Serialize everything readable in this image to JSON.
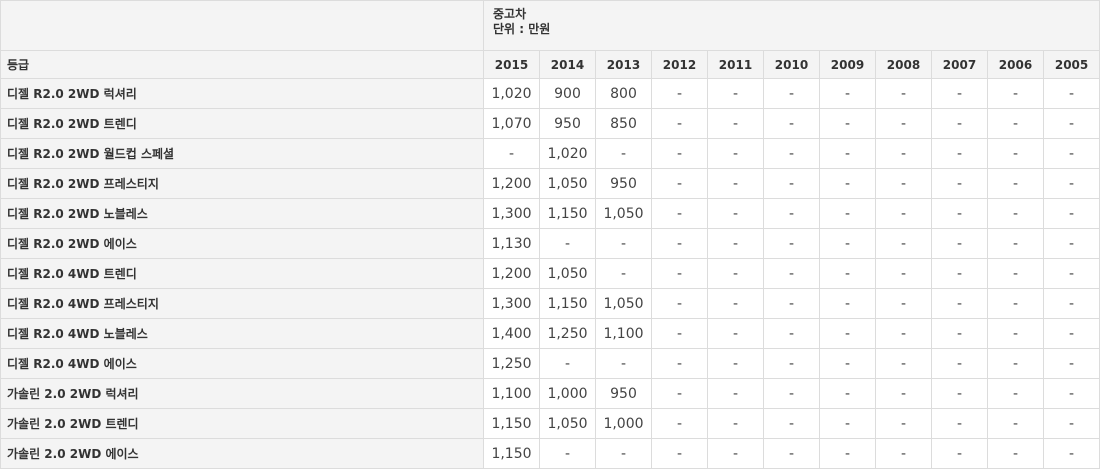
{
  "header": {
    "title": "중고차",
    "unit": "단위 : 만원",
    "grade_label": "등급",
    "years": [
      "2015",
      "2014",
      "2013",
      "2012",
      "2011",
      "2010",
      "2009",
      "2008",
      "2007",
      "2006",
      "2005"
    ]
  },
  "rows": [
    {
      "grade": "디젤 R2.0 2WD 럭셔리",
      "values": [
        "1,020",
        "900",
        "800",
        "-",
        "-",
        "-",
        "-",
        "-",
        "-",
        "-",
        "-"
      ]
    },
    {
      "grade": "디젤 R2.0 2WD 트렌디",
      "values": [
        "1,070",
        "950",
        "850",
        "-",
        "-",
        "-",
        "-",
        "-",
        "-",
        "-",
        "-"
      ]
    },
    {
      "grade": "디젤 R2.0 2WD 월드컵 스페셜",
      "values": [
        "-",
        "1,020",
        "-",
        "-",
        "-",
        "-",
        "-",
        "-",
        "-",
        "-",
        "-"
      ]
    },
    {
      "grade": "디젤 R2.0 2WD 프레스티지",
      "values": [
        "1,200",
        "1,050",
        "950",
        "-",
        "-",
        "-",
        "-",
        "-",
        "-",
        "-",
        "-"
      ]
    },
    {
      "grade": "디젤 R2.0 2WD 노블레스",
      "values": [
        "1,300",
        "1,150",
        "1,050",
        "-",
        "-",
        "-",
        "-",
        "-",
        "-",
        "-",
        "-"
      ]
    },
    {
      "grade": "디젤 R2.0 2WD 에이스",
      "values": [
        "1,130",
        "-",
        "-",
        "-",
        "-",
        "-",
        "-",
        "-",
        "-",
        "-",
        "-"
      ]
    },
    {
      "grade": "디젤 R2.0 4WD 트렌디",
      "values": [
        "1,200",
        "1,050",
        "-",
        "-",
        "-",
        "-",
        "-",
        "-",
        "-",
        "-",
        "-"
      ]
    },
    {
      "grade": "디젤 R2.0 4WD 프레스티지",
      "values": [
        "1,300",
        "1,150",
        "1,050",
        "-",
        "-",
        "-",
        "-",
        "-",
        "-",
        "-",
        "-"
      ]
    },
    {
      "grade": "디젤 R2.0 4WD 노블레스",
      "values": [
        "1,400",
        "1,250",
        "1,100",
        "-",
        "-",
        "-",
        "-",
        "-",
        "-",
        "-",
        "-"
      ]
    },
    {
      "grade": "디젤 R2.0 4WD 에이스",
      "values": [
        "1,250",
        "-",
        "-",
        "-",
        "-",
        "-",
        "-",
        "-",
        "-",
        "-",
        "-"
      ]
    },
    {
      "grade": "가솔린 2.0 2WD 럭셔리",
      "values": [
        "1,100",
        "1,000",
        "950",
        "-",
        "-",
        "-",
        "-",
        "-",
        "-",
        "-",
        "-"
      ]
    },
    {
      "grade": "가솔린 2.0 2WD 트렌디",
      "values": [
        "1,150",
        "1,050",
        "1,000",
        "-",
        "-",
        "-",
        "-",
        "-",
        "-",
        "-",
        "-"
      ]
    },
    {
      "grade": "가솔린 2.0 2WD 에이스",
      "values": [
        "1,150",
        "-",
        "-",
        "-",
        "-",
        "-",
        "-",
        "-",
        "-",
        "-",
        "-"
      ]
    }
  ]
}
